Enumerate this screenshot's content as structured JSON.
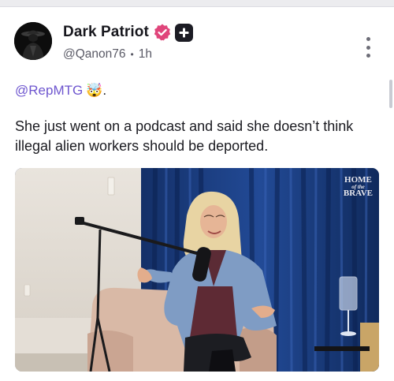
{
  "post": {
    "author": {
      "display_name": "Dark Patriot",
      "handle": "@Qanon76",
      "time_ago": "1h",
      "verified_icon": "verified-badge-icon",
      "plus_icon": "plus-badge-icon",
      "avatar_icon": "hooded-figure-avatar"
    },
    "mention": "@RepMTG",
    "mention_emoji": "🤯",
    "mention_suffix": ".",
    "body": "She just went on a podcast and said she doesn’t think illegal alien workers should be deported.",
    "media": {
      "type": "video-still",
      "watermark_line1": "HOME",
      "watermark_line2": "of the",
      "watermark_line3": "BRAVE"
    },
    "menu_icon": "more-vertical-icon"
  },
  "colors": {
    "accent": "#6e56cf",
    "verified_badge": "#e0457b",
    "curtain": "#1b3b7a",
    "text": "#17171d",
    "muted": "#5a5a66"
  }
}
